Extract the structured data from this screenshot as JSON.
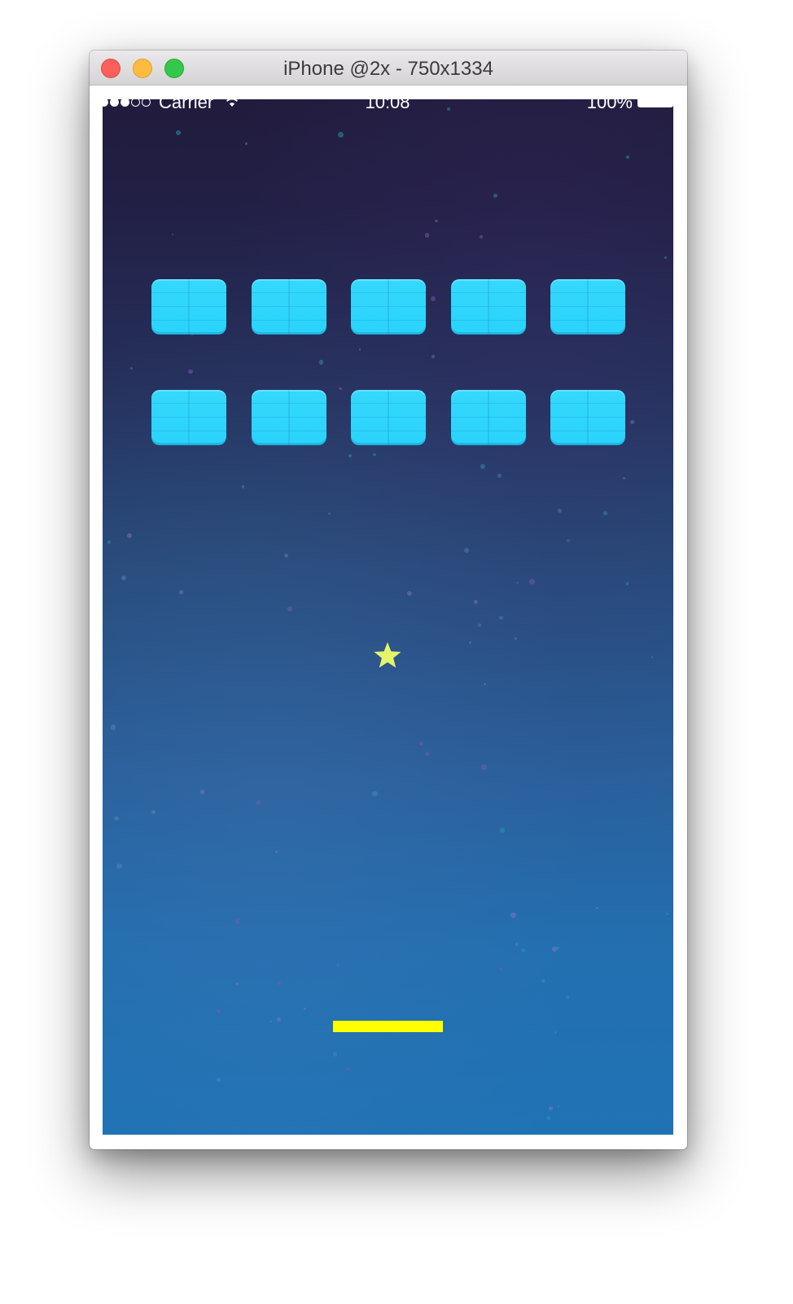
{
  "window": {
    "title": "iPhone @2x - 750x1334"
  },
  "status_bar": {
    "carrier": "Carrier",
    "time": "10:08",
    "battery": "100%",
    "signal_bars_filled": 3,
    "signal_bars_total": 5,
    "battery_level": 1.0,
    "icons": [
      "wifi-icon",
      "battery-icon"
    ]
  },
  "game": {
    "bricks": {
      "rows": 2,
      "columns": 5,
      "color": "#2ad3fb"
    },
    "ball": {
      "shape": "star",
      "color": "#e5f56a"
    },
    "paddle": {
      "color": "#ffff00"
    },
    "background": {
      "top_color": "#211c3d",
      "bottom_color": "#1f73b5"
    }
  },
  "colors": {
    "traffic_close": "#fc605b",
    "traffic_minimize": "#fdbc40",
    "traffic_zoom": "#34c84a"
  }
}
